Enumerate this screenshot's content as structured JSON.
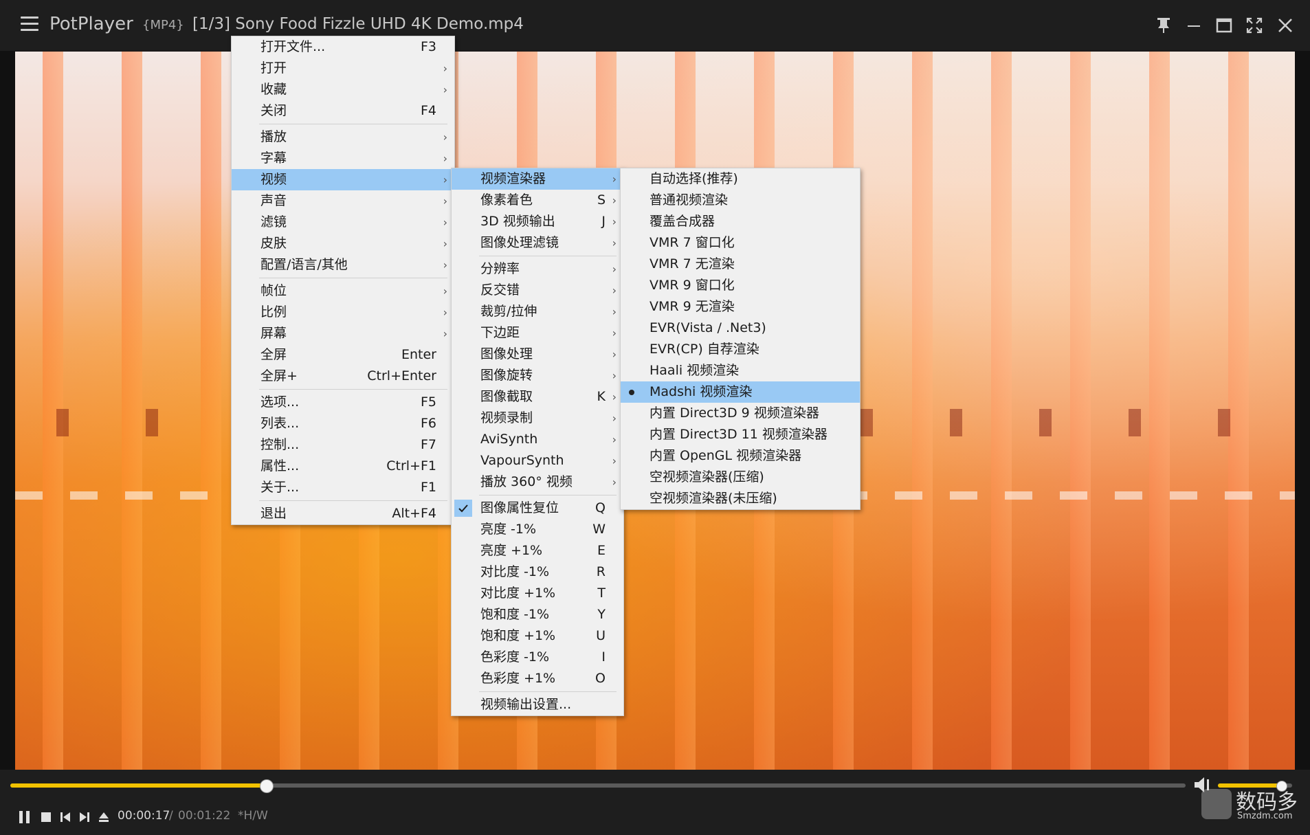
{
  "titlebar": {
    "app_name": "PotPlayer",
    "format_badge": "{MP4}",
    "title": "[1/3] Sony Food Fizzle UHD 4K Demo.mp4"
  },
  "menu_main": [
    {
      "label": "打开文件...",
      "shortcut": "F3",
      "arrow": ""
    },
    {
      "label": "打开",
      "shortcut": "",
      "arrow": "›"
    },
    {
      "label": "收藏",
      "shortcut": "",
      "arrow": "›"
    },
    {
      "label": "关闭",
      "shortcut": "F4",
      "arrow": ""
    },
    {
      "label": "播放",
      "shortcut": "",
      "arrow": "›"
    },
    {
      "label": "字幕",
      "shortcut": "",
      "arrow": "›"
    },
    {
      "label": "视频",
      "shortcut": "",
      "arrow": "›"
    },
    {
      "label": "声音",
      "shortcut": "",
      "arrow": "›"
    },
    {
      "label": "滤镜",
      "shortcut": "",
      "arrow": "›"
    },
    {
      "label": "皮肤",
      "shortcut": "",
      "arrow": "›"
    },
    {
      "label": "配置/语言/其他",
      "shortcut": "",
      "arrow": "›"
    },
    {
      "label": "帧位",
      "shortcut": "",
      "arrow": "›"
    },
    {
      "label": "比例",
      "shortcut": "",
      "arrow": "›"
    },
    {
      "label": "屏幕",
      "shortcut": "",
      "arrow": "›"
    },
    {
      "label": "全屏",
      "shortcut": "Enter",
      "arrow": ""
    },
    {
      "label": "全屏+",
      "shortcut": "Ctrl+Enter",
      "arrow": ""
    },
    {
      "label": "选项...",
      "shortcut": "F5",
      "arrow": ""
    },
    {
      "label": "列表...",
      "shortcut": "F6",
      "arrow": ""
    },
    {
      "label": "控制...",
      "shortcut": "F7",
      "arrow": ""
    },
    {
      "label": "属性...",
      "shortcut": "Ctrl+F1",
      "arrow": ""
    },
    {
      "label": "关于...",
      "shortcut": "F1",
      "arrow": ""
    },
    {
      "label": "退出",
      "shortcut": "Alt+F4",
      "arrow": ""
    }
  ],
  "menu_video": [
    {
      "label": "视频渲染器",
      "shortcut": "",
      "arrow": "›"
    },
    {
      "label": "像素着色",
      "shortcut": "S",
      "arrow": "›"
    },
    {
      "label": "3D 视频输出",
      "shortcut": "J",
      "arrow": "›"
    },
    {
      "label": "图像处理滤镜",
      "shortcut": "",
      "arrow": "›"
    },
    {
      "label": "分辨率",
      "shortcut": "",
      "arrow": "›"
    },
    {
      "label": "反交错",
      "shortcut": "",
      "arrow": "›"
    },
    {
      "label": "裁剪/拉伸",
      "shortcut": "",
      "arrow": "›"
    },
    {
      "label": "下边距",
      "shortcut": "",
      "arrow": "›"
    },
    {
      "label": "图像处理",
      "shortcut": "",
      "arrow": "›"
    },
    {
      "label": "图像旋转",
      "shortcut": "",
      "arrow": "›"
    },
    {
      "label": "图像截取",
      "shortcut": "K",
      "arrow": "›"
    },
    {
      "label": "视频录制",
      "shortcut": "",
      "arrow": "›"
    },
    {
      "label": "AviSynth",
      "shortcut": "",
      "arrow": "›"
    },
    {
      "label": "VapourSynth",
      "shortcut": "",
      "arrow": "›"
    },
    {
      "label": "播放 360° 视频",
      "shortcut": "",
      "arrow": "›"
    },
    {
      "label": "图像属性复位",
      "shortcut": "Q",
      "arrow": ""
    },
    {
      "label": "亮度 -1%",
      "shortcut": "W",
      "arrow": ""
    },
    {
      "label": "亮度 +1%",
      "shortcut": "E",
      "arrow": ""
    },
    {
      "label": "对比度 -1%",
      "shortcut": "R",
      "arrow": ""
    },
    {
      "label": "对比度 +1%",
      "shortcut": "T",
      "arrow": ""
    },
    {
      "label": "饱和度 -1%",
      "shortcut": "Y",
      "arrow": ""
    },
    {
      "label": "饱和度 +1%",
      "shortcut": "U",
      "arrow": ""
    },
    {
      "label": "色彩度 -1%",
      "shortcut": "I",
      "arrow": ""
    },
    {
      "label": "色彩度 +1%",
      "shortcut": "O",
      "arrow": ""
    },
    {
      "label": "视频输出设置...",
      "shortcut": "",
      "arrow": ""
    }
  ],
  "menu_renderer": [
    {
      "label": "自动选择(推荐)"
    },
    {
      "label": "普通视频渲染"
    },
    {
      "label": "覆盖合成器"
    },
    {
      "label": "VMR 7 窗口化"
    },
    {
      "label": "VMR 7 无渲染"
    },
    {
      "label": "VMR 9 窗口化"
    },
    {
      "label": "VMR 9 无渲染"
    },
    {
      "label": "EVR(Vista / .Net3)"
    },
    {
      "label": "EVR(CP) 自荐渲染"
    },
    {
      "label": "Haali 视频渲染"
    },
    {
      "label": "Madshi 视频渲染"
    },
    {
      "label": "内置 Direct3D 9 视频渲染器"
    },
    {
      "label": "内置 Direct3D 11 视频渲染器"
    },
    {
      "label": "内置 OpenGL 视频渲染器"
    },
    {
      "label": "空视频渲染器(压缩)"
    },
    {
      "label": "空视频渲染器(未压缩)"
    }
  ],
  "player": {
    "time_current": "00:00:17",
    "time_sep": "/",
    "time_total": "00:01:22",
    "hw_label": "*H/W",
    "seek_progress": 0.2176,
    "volume_level": 0.85,
    "accent_color": "#f2c200"
  },
  "watermark": {
    "text": "数码多",
    "sub": "Smzdm.com"
  }
}
